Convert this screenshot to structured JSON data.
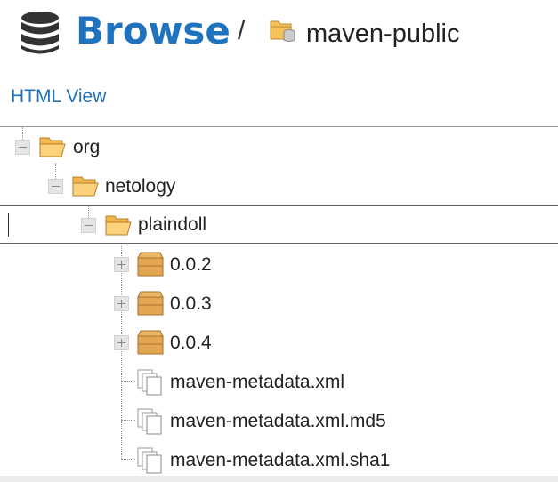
{
  "header": {
    "title": "Browse",
    "separator": "/",
    "repository": "maven-public",
    "db_icon": "database-icon",
    "repo_icon": "repository-folder-icon"
  },
  "toolbar": {
    "html_view": "HTML View"
  },
  "tree": {
    "nodes": [
      {
        "label": "org",
        "icon": "folder-open-icon",
        "toggle": "collapse"
      },
      {
        "label": "netology",
        "icon": "folder-open-icon",
        "toggle": "collapse"
      },
      {
        "label": "plaindoll",
        "icon": "folder-open-icon",
        "toggle": "collapse",
        "selected": true
      },
      {
        "label": "0.0.2",
        "icon": "component-box-icon",
        "toggle": "expand"
      },
      {
        "label": "0.0.3",
        "icon": "component-box-icon",
        "toggle": "expand"
      },
      {
        "label": "0.0.4",
        "icon": "component-box-icon",
        "toggle": "expand"
      },
      {
        "label": "maven-metadata.xml",
        "icon": "file-stack-icon"
      },
      {
        "label": "maven-metadata.xml.md5",
        "icon": "file-stack-icon"
      },
      {
        "label": "maven-metadata.xml.sha1",
        "icon": "file-stack-icon"
      }
    ]
  },
  "colors": {
    "accent": "#1e72be",
    "folder": "#f7c25a",
    "box": "#e3a54f"
  }
}
